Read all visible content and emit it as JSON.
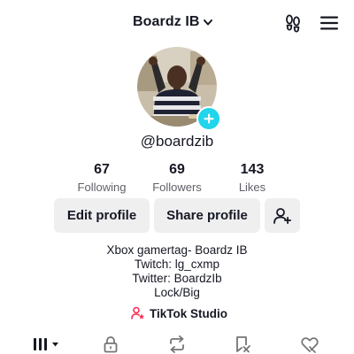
{
  "header": {
    "account_name": "Boardz IB",
    "icons": [
      "chevron-down-icon",
      "footprints-icon",
      "menu-icon"
    ]
  },
  "profile": {
    "handle": "@boardzib",
    "accent_color": "#20d5ec"
  },
  "stats": [
    {
      "value": "67",
      "label": "Following"
    },
    {
      "value": "69",
      "label": "Followers"
    },
    {
      "value": "143",
      "label": "Likes"
    }
  ],
  "actions": {
    "edit_label": "Edit profile",
    "share_label": "Share profile"
  },
  "bio": {
    "lines": [
      "Xbox gamertag- Boardz IB",
      "Twitch: lg_cxmp",
      "Twitter: BoardzIb",
      "Lock/Big"
    ]
  },
  "studio": {
    "label": "TikTok Studio",
    "icon_color": "#fe2c55"
  },
  "tabs": [
    "videos-grid-icon",
    "lock-icon",
    "repost-icon",
    "favorites-icon",
    "liked-heart-icon"
  ]
}
